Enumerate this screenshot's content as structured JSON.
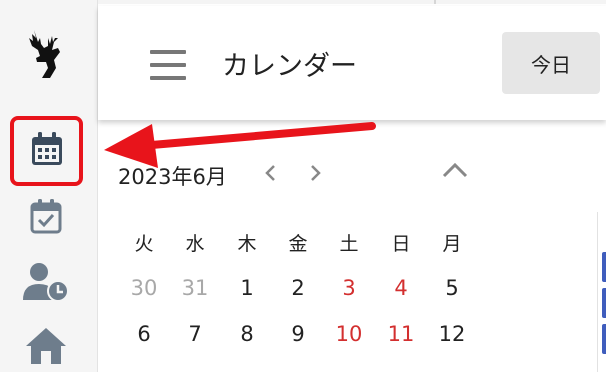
{
  "header": {
    "title": "カレンダー",
    "today_label": "今日"
  },
  "sidebar": {
    "logo_icon": "deer-logo-icon",
    "items": [
      {
        "icon": "calendar-icon",
        "active": true
      },
      {
        "icon": "calendar-check-icon",
        "active": false
      },
      {
        "icon": "user-clock-icon",
        "active": false
      },
      {
        "icon": "home-icon",
        "active": false
      }
    ]
  },
  "calendar": {
    "month_label": "2023年6月",
    "weekdays": [
      "火",
      "水",
      "木",
      "金",
      "土",
      "日",
      "月"
    ],
    "weeks": [
      [
        "30",
        "31",
        "1",
        "2",
        "3",
        "4",
        "5"
      ],
      [
        "6",
        "7",
        "8",
        "9",
        "10",
        "11",
        "12"
      ]
    ]
  },
  "colors": {
    "highlight_border": "#e8141b",
    "arrow": "#e8141b",
    "weekend": "#d32f2f",
    "muted": "#a8a8a8",
    "accent": "#3f5dbd"
  }
}
